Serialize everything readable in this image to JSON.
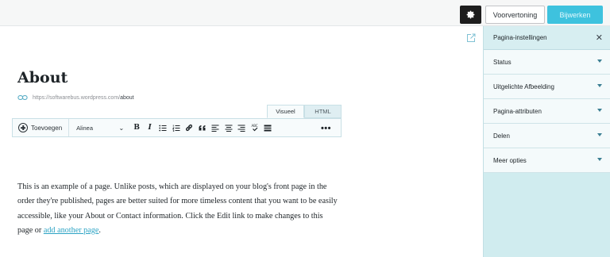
{
  "topbar": {
    "settings_icon": "gear-icon",
    "preview_label": "Voorvertoning",
    "update_label": "Bijwerken"
  },
  "editor": {
    "external_icon": "external-link-icon",
    "title": "About",
    "permalink": {
      "icon": "link-icon",
      "base": "https://softwarebus.wordpress.com/",
      "slug": "about"
    },
    "tabs": [
      {
        "label": "Visueel",
        "active": true
      },
      {
        "label": "HTML",
        "active": false
      }
    ],
    "toolbar": {
      "add_label": "Toevoegen",
      "format_value": "Alinea",
      "buttons": [
        "bold",
        "italic",
        "bullet-list",
        "numbered-list",
        "link",
        "blockquote",
        "align-left",
        "align-center",
        "align-right",
        "spellcheck",
        "toolbar-toggle"
      ],
      "more_label": "•••"
    },
    "content": {
      "text": "This is an example of a page. Unlike posts, which are displayed on your blog's front page in the order they're published, pages are better suited for more timeless content that you want to be easily accessible, like your About or Contact information. Click the Edit link to make changes to this page or ",
      "link_text": "add another page",
      "after_link": "."
    }
  },
  "sidebar": {
    "title": "Pagina-instellingen",
    "close_icon": "close-icon",
    "sections": [
      {
        "label": "Status"
      },
      {
        "label": "Uitgelichte Afbeelding"
      },
      {
        "label": "Pagina-attributen"
      },
      {
        "label": "Delen"
      },
      {
        "label": "Meer opties"
      }
    ]
  },
  "colors": {
    "accent": "#3ec2de",
    "sidebar_bg": "#d0ecef",
    "link": "#2ba3c4"
  }
}
